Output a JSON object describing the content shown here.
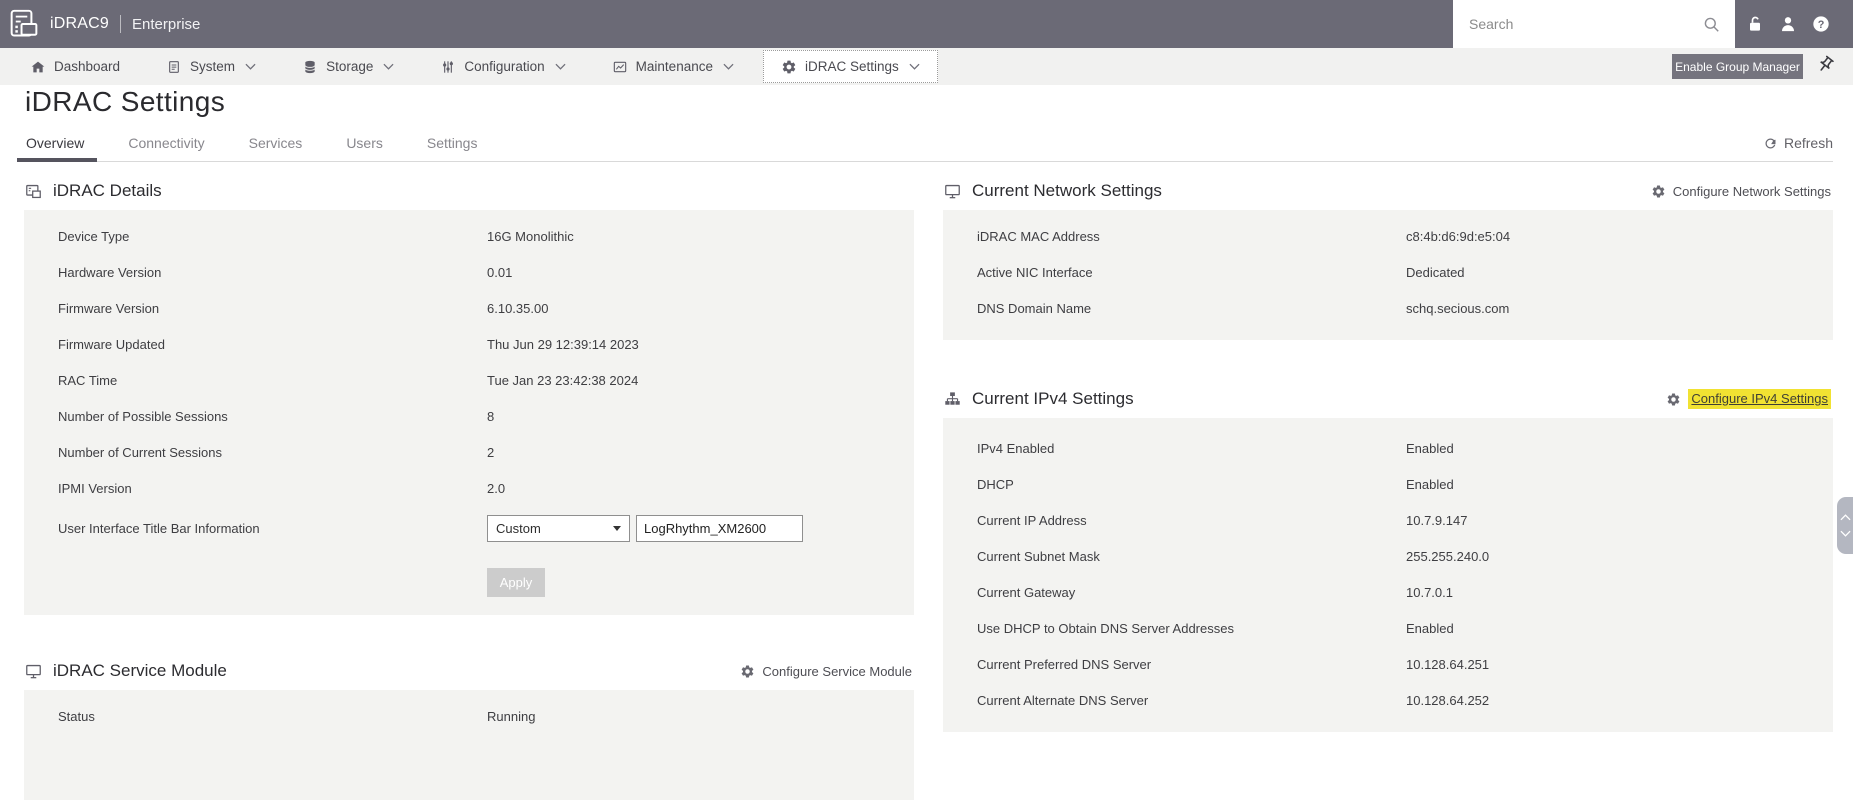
{
  "topbar": {
    "brand": "iDRAC9",
    "edition": "Enterprise",
    "search_placeholder": "Search"
  },
  "navbar": {
    "items": [
      {
        "label": "Dashboard",
        "icon": "home-icon",
        "dropdown": false,
        "active": false
      },
      {
        "label": "System",
        "icon": "system-icon",
        "dropdown": true,
        "active": false
      },
      {
        "label": "Storage",
        "icon": "storage-icon",
        "dropdown": true,
        "active": false
      },
      {
        "label": "Configuration",
        "icon": "configuration-icon",
        "dropdown": true,
        "active": false
      },
      {
        "label": "Maintenance",
        "icon": "maintenance-icon",
        "dropdown": true,
        "active": false
      },
      {
        "label": "iDRAC Settings",
        "icon": "gear-icon",
        "dropdown": true,
        "active": true
      }
    ],
    "enable_group_manager_label": "Enable Group Manager"
  },
  "page": {
    "title": "iDRAC Settings",
    "tabs": [
      {
        "label": "Overview",
        "active": true
      },
      {
        "label": "Connectivity",
        "active": false
      },
      {
        "label": "Services",
        "active": false
      },
      {
        "label": "Users",
        "active": false
      },
      {
        "label": "Settings",
        "active": false
      }
    ],
    "refresh_label": "Refresh"
  },
  "panels": {
    "idrac_details": {
      "title": "iDRAC Details",
      "rows": [
        {
          "label": "Device Type",
          "value": "16G Monolithic"
        },
        {
          "label": "Hardware Version",
          "value": "0.01"
        },
        {
          "label": "Firmware Version",
          "value": "6.10.35.00"
        },
        {
          "label": "Firmware Updated",
          "value": "Thu Jun 29 12:39:14 2023"
        },
        {
          "label": "RAC Time",
          "value": "Tue Jan 23 23:42:38 2024"
        },
        {
          "label": "Number of Possible Sessions",
          "value": "8"
        },
        {
          "label": "Number of Current Sessions",
          "value": "2"
        },
        {
          "label": "IPMI Version",
          "value": "2.0"
        }
      ],
      "title_bar_row": {
        "label": "User Interface Title Bar Information",
        "select_value": "Custom",
        "input_value": "LogRhythm_XM2600",
        "apply_label": "Apply"
      }
    },
    "service_module": {
      "title": "iDRAC Service Module",
      "action_label": "Configure Service Module",
      "rows": [
        {
          "label": "Status",
          "value": "Running"
        }
      ]
    },
    "network_settings": {
      "title": "Current Network Settings",
      "action_label": "Configure Network Settings",
      "rows": [
        {
          "label": "iDRAC MAC Address",
          "value": "c8:4b:d6:9d:e5:04"
        },
        {
          "label": "Active NIC Interface",
          "value": "Dedicated"
        },
        {
          "label": "DNS Domain Name",
          "value": "schq.secious.com"
        }
      ]
    },
    "ipv4_settings": {
      "title": "Current IPv4 Settings",
      "action_label": "Configure IPv4 Settings",
      "action_highlighted": true,
      "rows": [
        {
          "label": "IPv4 Enabled",
          "value": "Enabled"
        },
        {
          "label": "DHCP",
          "value": "Enabled"
        },
        {
          "label": "Current IP Address",
          "value": "10.7.9.147"
        },
        {
          "label": "Current Subnet Mask",
          "value": "255.255.240.0"
        },
        {
          "label": "Current Gateway",
          "value": "10.7.0.1"
        },
        {
          "label": "Use DHCP to Obtain DNS Server Addresses",
          "value": "Enabled"
        },
        {
          "label": "Current Preferred DNS Server",
          "value": "10.128.64.251"
        },
        {
          "label": "Current Alternate DNS Server",
          "value": "10.128.64.252"
        }
      ]
    }
  },
  "colors": {
    "topbar_bg": "#6b6a76",
    "navbar_bg": "#f1f1f0",
    "panel_body_bg": "#f3f3f1",
    "highlight_yellow": "#f1e232",
    "active_tab_underline": "#55545e",
    "group_manager_button_bg": "#75747e",
    "apply_disabled_bg": "#cccccc"
  }
}
